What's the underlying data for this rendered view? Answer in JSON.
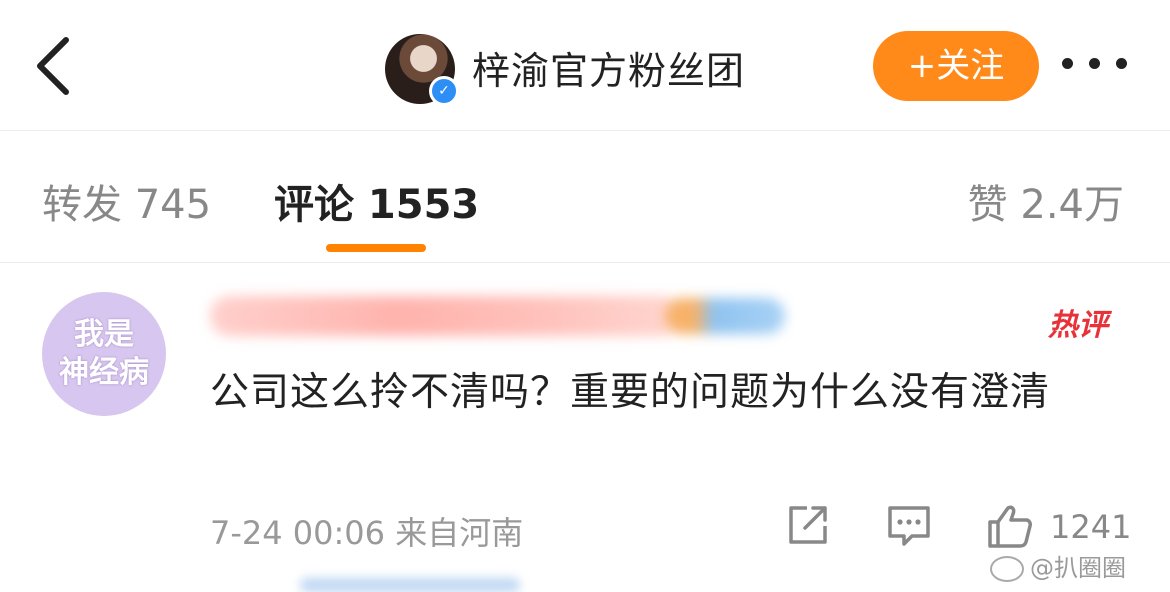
{
  "header": {
    "title": "梓渝官方粉丝团",
    "follow_label": "+关注",
    "verified_mark": "✓"
  },
  "tabs": {
    "repost": "转发 745",
    "comment": "评论 1553",
    "like": "赞 2.4万"
  },
  "comment": {
    "avatar_text_line1": "我是",
    "avatar_text_line2": "神经病",
    "hot_badge": "热评",
    "text": "公司这么拎不清吗？重要的问题为什么没有澄清",
    "meta": "7-24 00:06 来自河南",
    "like_count": "1241"
  },
  "watermark": "@扒圈圈",
  "colors": {
    "accent_orange": "#ff8200",
    "follow_bg": "#ff8a1a",
    "hot_red": "#e8323a",
    "verified_blue": "#2d8ef5",
    "avatar_lilac": "#d7c6ef"
  },
  "icons": [
    "back-arrow-icon",
    "verified-icon",
    "more-dots-icon",
    "share-icon",
    "reply-icon",
    "thumbs-up-icon",
    "weibo-logo-icon"
  ]
}
